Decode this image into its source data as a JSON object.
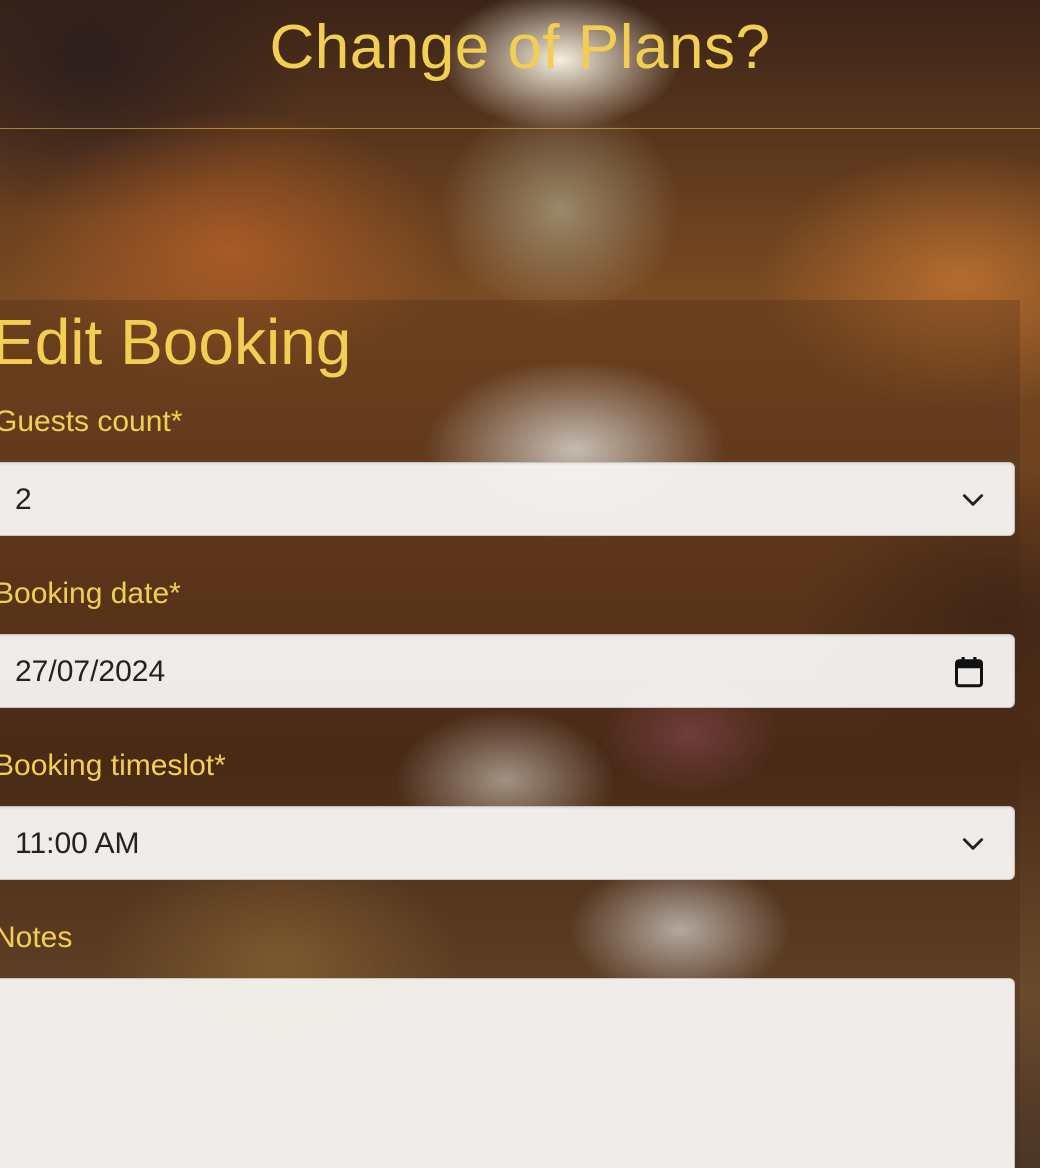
{
  "header": {
    "title": "Change of Plans?"
  },
  "form": {
    "title": "Edit Booking",
    "guests": {
      "label": "Guests count*",
      "value": "2"
    },
    "date": {
      "label": "Booking date*",
      "value": "27/07/2024"
    },
    "timeslot": {
      "label": "Booking timeslot*",
      "value": "11:00 AM"
    },
    "notes": {
      "label": "Notes",
      "value": ""
    }
  },
  "icons": {
    "dropdown": "chevron-down-icon",
    "date_picker": "calendar-icon"
  },
  "colors": {
    "accent": "#f2cf52",
    "input_bg": "#f5f2f0",
    "input_text": "#222222"
  }
}
